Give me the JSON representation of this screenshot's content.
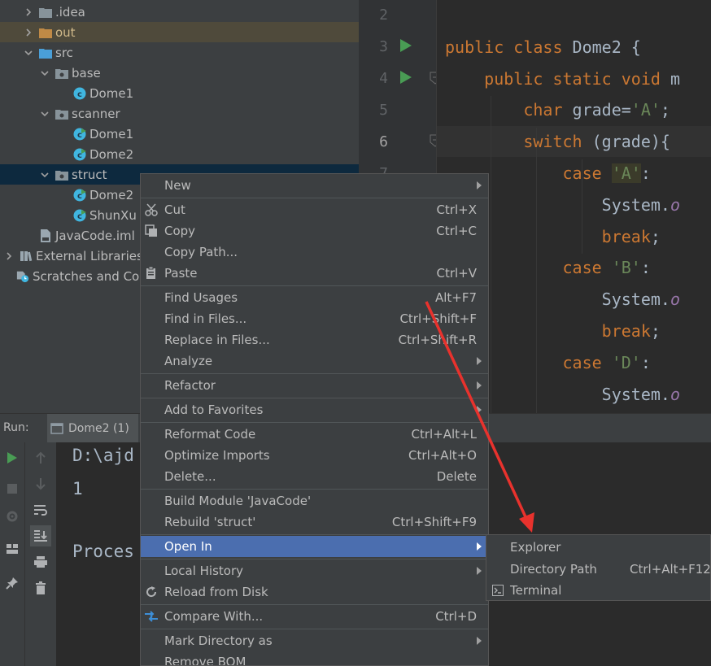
{
  "colors": {
    "accent": "#4b6eaf",
    "annotation": "#e8322d",
    "folder": "#87939a",
    "out_folder": "#c08a46",
    "src_folder": "#4a9fd8",
    "run_green": "#499c54",
    "class_icon": "#40b6e0"
  },
  "tree": {
    "items": [
      {
        "label": ".idea",
        "arrow": "right",
        "icon": "folder-icon"
      },
      {
        "label": "out",
        "arrow": "down-right",
        "icon": "folder-out-icon"
      },
      {
        "label": "src",
        "arrow": "down",
        "icon": "folder-src-icon"
      },
      {
        "label": "base",
        "arrow": "down",
        "icon": "package-icon"
      },
      {
        "label": "Dome1",
        "arrow": "",
        "icon": "class-icon"
      },
      {
        "label": "scanner",
        "arrow": "down",
        "icon": "package-icon"
      },
      {
        "label": "Dome1",
        "arrow": "",
        "icon": "class-runnable-icon"
      },
      {
        "label": "Dome2",
        "arrow": "",
        "icon": "class-runnable-icon"
      },
      {
        "label": "struct",
        "arrow": "down",
        "icon": "package-icon"
      },
      {
        "label": "Dome2",
        "arrow": "",
        "icon": "class-runnable-icon"
      },
      {
        "label": "ShunXu",
        "arrow": "",
        "icon": "class-runnable-icon"
      },
      {
        "label": "JavaCode.iml",
        "arrow": "",
        "icon": "iml-file-icon"
      },
      {
        "label": "External Libraries",
        "arrow": "right",
        "icon": "library-icon"
      },
      {
        "label": "Scratches and Co",
        "arrow": "",
        "icon": "scratches-icon"
      }
    ]
  },
  "editor": {
    "line_numbers": [
      "2",
      "3",
      "4",
      "5",
      "6",
      "7"
    ],
    "lines": [
      {
        "parts": []
      },
      {
        "parts": [
          [
            "kw",
            "public class "
          ],
          [
            "plain",
            "Dome2 {"
          ]
        ]
      },
      {
        "parts": [
          [
            "plain",
            "    "
          ],
          [
            "kw",
            "public static void "
          ],
          [
            "plain",
            "m"
          ]
        ]
      },
      {
        "parts": [
          [
            "plain",
            "        "
          ],
          [
            "kw",
            "char "
          ],
          [
            "plain",
            "grade="
          ],
          [
            "str",
            "'A'"
          ],
          [
            "plain",
            ";"
          ]
        ]
      },
      {
        "parts": [
          [
            "plain",
            "        "
          ],
          [
            "kw",
            "switch "
          ],
          [
            "plain",
            "(grade){"
          ]
        ]
      },
      {
        "parts": [
          [
            "plain",
            "            "
          ],
          [
            "kw",
            "case "
          ],
          [
            "strhl",
            "'A'"
          ],
          [
            "plain",
            ":"
          ]
        ]
      },
      {
        "parts": [
          [
            "plain",
            "                System."
          ],
          [
            "italic",
            "o"
          ]
        ]
      },
      {
        "parts": [
          [
            "plain",
            "                "
          ],
          [
            "kw",
            "break"
          ],
          [
            "plain",
            ";"
          ]
        ]
      },
      {
        "parts": [
          [
            "plain",
            "            "
          ],
          [
            "kw",
            "case "
          ],
          [
            "str",
            "'B'"
          ],
          [
            "plain",
            ":"
          ]
        ]
      },
      {
        "parts": [
          [
            "plain",
            "                System."
          ],
          [
            "italic",
            "o"
          ]
        ]
      },
      {
        "parts": [
          [
            "plain",
            "                "
          ],
          [
            "kw",
            "break"
          ],
          [
            "plain",
            ";"
          ]
        ]
      },
      {
        "parts": [
          [
            "plain",
            "            "
          ],
          [
            "kw",
            "case "
          ],
          [
            "str",
            "'D'"
          ],
          [
            "plain",
            ":"
          ]
        ]
      },
      {
        "parts": [
          [
            "plain",
            "                System."
          ],
          [
            "italic",
            "o"
          ]
        ]
      }
    ]
  },
  "run": {
    "label": "Run:",
    "tab": "Dome2 (1)",
    "console": [
      "D:\\ajd",
      "1",
      "",
      "Proces"
    ]
  },
  "context_menu": {
    "items": [
      {
        "label": "New",
        "shortcut": "",
        "submenu": true,
        "icon": ""
      },
      {
        "sep": true
      },
      {
        "label": "Cut",
        "shortcut": "Ctrl+X",
        "icon": "scissors-icon"
      },
      {
        "label": "Copy",
        "shortcut": "Ctrl+C",
        "icon": "copy-icon"
      },
      {
        "label": "Copy Path...",
        "shortcut": "",
        "icon": ""
      },
      {
        "label": "Paste",
        "shortcut": "Ctrl+V",
        "icon": "paste-icon"
      },
      {
        "sep": true
      },
      {
        "label": "Find Usages",
        "shortcut": "Alt+F7",
        "icon": ""
      },
      {
        "label": "Find in Files...",
        "shortcut": "Ctrl+Shift+F",
        "icon": ""
      },
      {
        "label": "Replace in Files...",
        "shortcut": "Ctrl+Shift+R",
        "icon": ""
      },
      {
        "label": "Analyze",
        "shortcut": "",
        "submenu": true,
        "icon": ""
      },
      {
        "sep": true
      },
      {
        "label": "Refactor",
        "shortcut": "",
        "submenu": true,
        "icon": ""
      },
      {
        "sep": true
      },
      {
        "label": "Add to Favorites",
        "shortcut": "",
        "submenu": true,
        "icon": ""
      },
      {
        "sep": true
      },
      {
        "label": "Reformat Code",
        "shortcut": "Ctrl+Alt+L",
        "icon": ""
      },
      {
        "label": "Optimize Imports",
        "shortcut": "Ctrl+Alt+O",
        "icon": ""
      },
      {
        "label": "Delete...",
        "shortcut": "Delete",
        "icon": ""
      },
      {
        "sep": true
      },
      {
        "label": "Build Module 'JavaCode'",
        "shortcut": "",
        "icon": ""
      },
      {
        "label": "Rebuild 'struct'",
        "shortcut": "Ctrl+Shift+F9",
        "icon": ""
      },
      {
        "sep": true
      },
      {
        "label": "Open In",
        "shortcut": "",
        "submenu": true,
        "active": true,
        "icon": ""
      },
      {
        "sep": true
      },
      {
        "label": "Local History",
        "shortcut": "",
        "submenu": true,
        "icon": ""
      },
      {
        "label": "Reload from Disk",
        "shortcut": "",
        "icon": "reload-icon"
      },
      {
        "sep": true
      },
      {
        "label": "Compare With...",
        "shortcut": "Ctrl+D",
        "icon": "compare-icon"
      },
      {
        "sep": true
      },
      {
        "label": "Mark Directory as",
        "shortcut": "",
        "submenu": true,
        "icon": ""
      },
      {
        "label": "Remove BOM",
        "shortcut": "",
        "icon": ""
      }
    ]
  },
  "submenu": {
    "items": [
      {
        "label": "Explorer",
        "shortcut": "",
        "icon": ""
      },
      {
        "label": "Directory Path",
        "shortcut": "Ctrl+Alt+F12",
        "icon": ""
      },
      {
        "label": "Terminal",
        "shortcut": "",
        "icon": "terminal-icon"
      }
    ]
  }
}
